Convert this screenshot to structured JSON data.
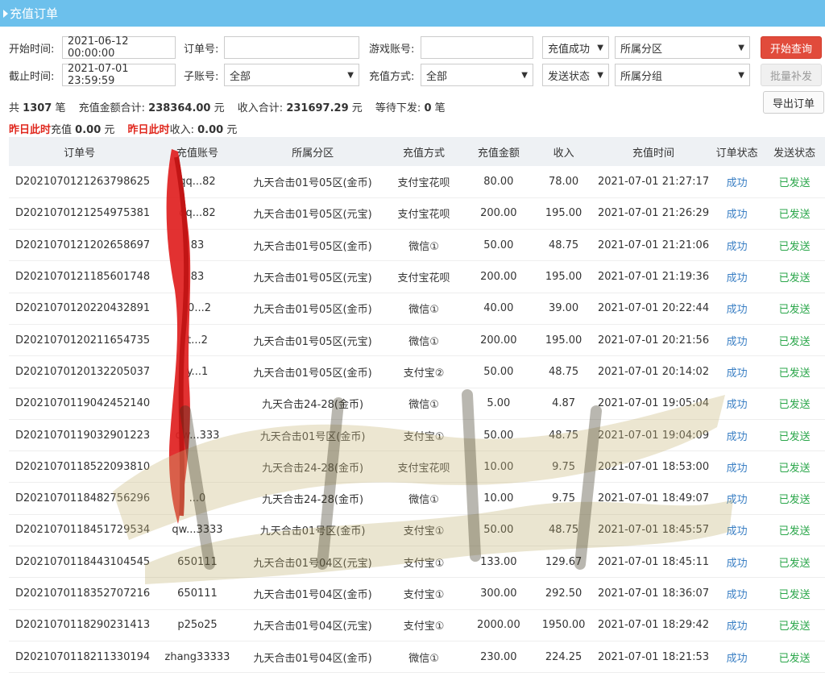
{
  "title": "充值订单",
  "filters": {
    "start_label": "开始时间:",
    "start_value": "2021-06-12 00:00:00",
    "end_label": "截止时间:",
    "end_value": "2021-07-01 23:59:59",
    "order_label": "订单号:",
    "order_value": "",
    "subaccount_label": "子账号:",
    "subaccount_value": "全部",
    "game_account_label": "游戏账号:",
    "game_account_value": "",
    "pay_method_label": "充值方式:",
    "pay_method_value": "全部",
    "status_select": "充值成功",
    "send_status_select": "发送状态",
    "region_select": "所属分区",
    "group_select": "所属分组",
    "search_button": "开始查询",
    "batch_button": "批量补发",
    "export_button": "导出订单"
  },
  "summary": {
    "total_prefix": "共",
    "total_count": "1307",
    "total_suffix": "笔",
    "amount_label": "充值金额合计:",
    "amount_value": "238364.00",
    "amount_unit": "元",
    "income_label": "收入合计:",
    "income_value": "231697.29",
    "income_unit": "元",
    "pending_label": "等待下发:",
    "pending_value": "0",
    "pending_unit": "笔"
  },
  "yesterday": {
    "label1": "昨日此时",
    "text1": "充值",
    "value1": "0.00",
    "unit1": "元",
    "label2": "昨日此时",
    "text2": "收入:",
    "value2": "0.00",
    "unit2": "元"
  },
  "table": {
    "headers": [
      "订单号",
      "充值账号",
      "所属分区",
      "充值方式",
      "充值金额",
      "收入",
      "充值时间",
      "订单状态",
      "发送状态"
    ],
    "rows": [
      [
        "D202107012126379862​5",
        "qq...82",
        "九天合击01号05区(金币)",
        "支付宝花呗",
        "80.00",
        "78.00",
        "2021-07-01 21:27:17",
        "成功",
        "已发送"
      ],
      [
        "D202107012125497538​1",
        "qq...82",
        "九天合击01号05区(元宝)",
        "支付宝花呗",
        "200.00",
        "195.00",
        "2021-07-01 21:26:29",
        "成功",
        "已发送"
      ],
      [
        "D202107012120265869​7",
        "83",
        "九天合击01号05区(金币)",
        "微信①",
        "50.00",
        "48.75",
        "2021-07-01 21:21:06",
        "成功",
        "已发送"
      ],
      [
        "D202107012118560174​8",
        "83",
        "九天合击01号05区(元宝)",
        "支付宝花呗",
        "200.00",
        "195.00",
        "2021-07-01 21:19:36",
        "成功",
        "已发送"
      ],
      [
        "D202107012022043289​1",
        "t0...2",
        "九天合击01号05区(金币)",
        "微信①",
        "40.00",
        "39.00",
        "2021-07-01 20:22:44",
        "成功",
        "已发送"
      ],
      [
        "D202107012021165473​5",
        "t...2",
        "九天合击01号05区(元宝)",
        "微信①",
        "200.00",
        "195.00",
        "2021-07-01 20:21:56",
        "成功",
        "已发送"
      ],
      [
        "D202107012013220503​7",
        "y...1",
        "九天合击01号05区(金币)",
        "支付宝②",
        "50.00",
        "48.75",
        "2021-07-01 20:14:02",
        "成功",
        "已发送"
      ],
      [
        "D202107011904245214​0",
        "",
        "九天合击24-28(金币)",
        "微信①",
        "5.00",
        "4.87",
        "2021-07-01 19:05:04",
        "成功",
        "已发送"
      ],
      [
        "D202107011903290122​3",
        "qw...333",
        "九天合击01号区(金币)",
        "支付宝①",
        "50.00",
        "48.75",
        "2021-07-01 19:04:09",
        "成功",
        "已发送"
      ],
      [
        "D202107011852209381​0",
        "",
        "九天合击24-28(金币)",
        "支付宝花呗",
        "10.00",
        "9.75",
        "2021-07-01 18:53:00",
        "成功",
        "已发送"
      ],
      [
        "D202107011848275629​6",
        "...0",
        "九天合击24-28(金币)",
        "微信①",
        "10.00",
        "9.75",
        "2021-07-01 18:49:07",
        "成功",
        "已发送"
      ],
      [
        "D202107011845172953​4",
        "qw...3333",
        "九天合击01号区(金币)",
        "支付宝①",
        "50.00",
        "48.75",
        "2021-07-01 18:45:57",
        "成功",
        "已发送"
      ],
      [
        "D202107011844310454​5",
        "650111",
        "九天合击01号04区(元宝)",
        "支付宝①",
        "133.00",
        "129.67",
        "2021-07-01 18:45:11",
        "成功",
        "已发送"
      ],
      [
        "D202107011835270721​6",
        "650111",
        "九天合击01号04区(金币)",
        "支付宝①",
        "300.00",
        "292.50",
        "2021-07-01 18:36:07",
        "成功",
        "已发送"
      ],
      [
        "D202107011829023141​3",
        "p25o25",
        "九天合击01号04区(元宝)",
        "支付宝①",
        "2000.00",
        "1950.00",
        "2021-07-01 18:29:42",
        "成功",
        "已发送"
      ],
      [
        "D202107011821133019​4",
        "zhang33333",
        "九天合击01号04区(金币)",
        "微信①",
        "230.00",
        "224.25",
        "2021-07-01 18:21:53",
        "成功",
        "已发送"
      ]
    ]
  },
  "colors": {
    "titlebar": "#6cc0ec",
    "search_button": "#e14b3b",
    "status_ok": "#3a7fc4",
    "sent": "#2aa64a",
    "highlight_red": "#e0281e"
  }
}
